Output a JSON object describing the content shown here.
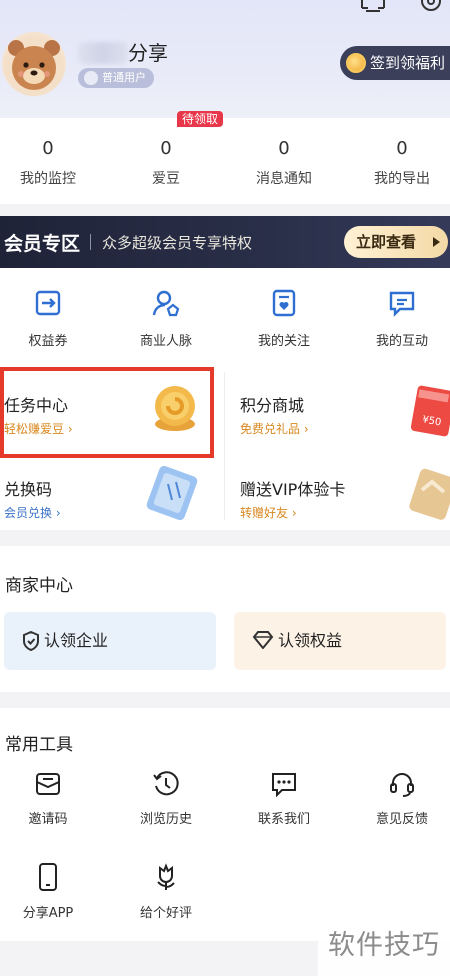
{
  "header": {
    "username_visible": "分享",
    "user_badge": "普通用户",
    "signin_label": "签到领福利"
  },
  "stats": [
    {
      "value": "0",
      "label": "我的监控"
    },
    {
      "value": "0",
      "label": "爱豆"
    },
    {
      "value": "0",
      "label": "消息通知"
    },
    {
      "value": "0",
      "label": "我的导出"
    }
  ],
  "pending_tag": "待领取",
  "vip": {
    "title": "会员专区",
    "desc": "众多超级会员专享特权",
    "button": "立即查看"
  },
  "quick": [
    {
      "label": "权益券",
      "icon": "voucher-icon"
    },
    {
      "label": "商业人脉",
      "icon": "contacts-icon"
    },
    {
      "label": "我的关注",
      "icon": "follow-icon"
    },
    {
      "label": "我的互动",
      "icon": "message-icon"
    }
  ],
  "cards": [
    {
      "title": "任务中心",
      "sub": "轻松赚爱豆 ›"
    },
    {
      "title": "积分商城",
      "sub": "免费兑礼品 ›"
    },
    {
      "title": "兑换码",
      "sub": "会员兑换 ›"
    },
    {
      "title": "赠送VIP体验卡",
      "sub": "转赠好友 ›"
    }
  ],
  "merchant": {
    "title": "商家中心",
    "claim_company": "认领企业",
    "claim_rights": "认领权益"
  },
  "tools": {
    "title": "常用工具",
    "items": [
      {
        "label": "邀请码",
        "icon": "invite-code-icon"
      },
      {
        "label": "浏览历史",
        "icon": "history-icon"
      },
      {
        "label": "联系我们",
        "icon": "chat-icon"
      },
      {
        "label": "意见反馈",
        "icon": "headset-icon"
      },
      {
        "label": "分享APP",
        "icon": "phone-icon"
      },
      {
        "label": "给个好评",
        "icon": "flower-icon"
      }
    ]
  },
  "watermark": "软件技巧",
  "colors": {
    "accent_red": "#e53a2a",
    "vip_bg": "#1f2338",
    "icon_blue": "#2f6fd1",
    "gold": "#d88820"
  }
}
